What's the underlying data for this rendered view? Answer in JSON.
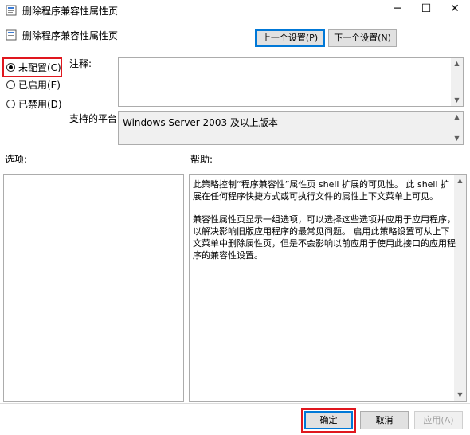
{
  "window": {
    "title": "删除程序兼容性属性页",
    "controls": {
      "minimize": "─",
      "maximize": "☐",
      "close": "✕"
    }
  },
  "header": {
    "title": "删除程序兼容性属性页"
  },
  "nav": {
    "prev_label": "上一个设置(P)",
    "next_label": "下一个设置(N)"
  },
  "state": {
    "options": [
      {
        "label": "未配置(C)",
        "checked": true
      },
      {
        "label": "已启用(E)",
        "checked": false
      },
      {
        "label": "已禁用(D)",
        "checked": false
      }
    ]
  },
  "comment": {
    "label": "注释:",
    "value": ""
  },
  "supported": {
    "label": "支持的平台:",
    "value": "Windows Server 2003 及以上版本"
  },
  "options_pane": {
    "label": "选项:"
  },
  "help": {
    "label": "帮助:",
    "paragraphs": [
      "此策略控制“程序兼容性”属性页 shell 扩展的可见性。 此 shell 扩展在任何程序快捷方式或可执行文件的属性上下文菜单上可见。",
      "兼容性属性页显示一组选项，可以选择这些选项并应用于应用程序，以解决影响旧版应用程序的最常见问题。 启用此策略设置可从上下文菜单中删除属性页，但是不会影响以前应用于使用此接口的应用程序的兼容性设置。"
    ]
  },
  "footer": {
    "ok_label": "确定",
    "cancel_label": "取消",
    "apply_label": "应用(A)"
  },
  "colors": {
    "highlight_red": "#e0171e",
    "focus_blue": "#0078d7"
  }
}
